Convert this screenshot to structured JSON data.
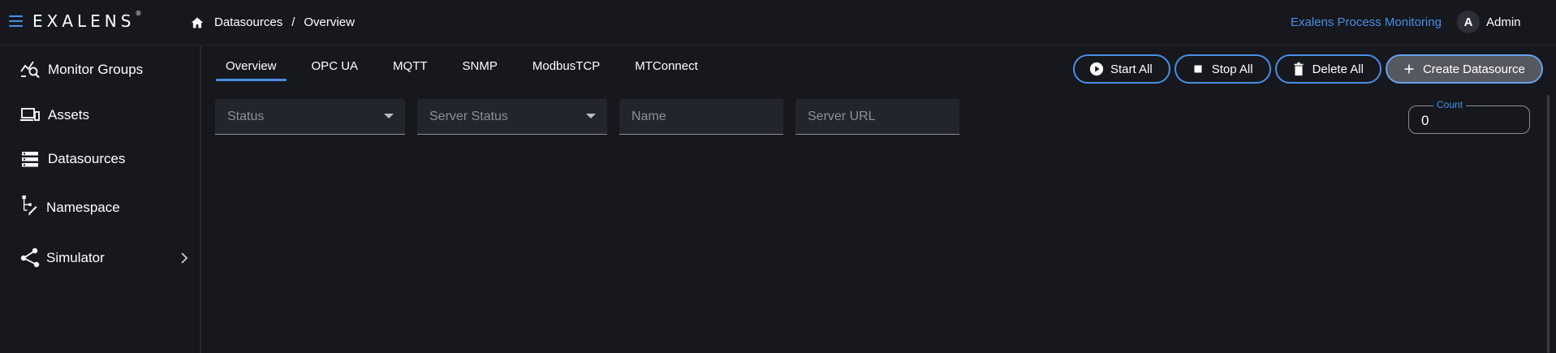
{
  "header": {
    "logo_text": "EXALENS",
    "logo_mark": "®",
    "breadcrumb": [
      "Datasources",
      "Overview"
    ],
    "breadcrumb_sep": "/",
    "app_link": "Exalens Process Monitoring",
    "user": {
      "initial": "A",
      "name": "Admin"
    }
  },
  "sidebar": {
    "items": [
      {
        "label": "Monitor Groups",
        "icon": "monitor-groups-icon"
      },
      {
        "label": "Assets",
        "icon": "assets-icon"
      },
      {
        "label": "Datasources",
        "icon": "datasources-icon"
      },
      {
        "label": "Namespace",
        "icon": "namespace-icon"
      },
      {
        "label": "Simulator",
        "icon": "simulator-icon"
      }
    ]
  },
  "tabs": [
    "Overview",
    "OPC UA",
    "MQTT",
    "SNMP",
    "ModbusTCP",
    "MTConnect"
  ],
  "actions": {
    "start_all": "Start All",
    "stop_all": "Stop All",
    "delete_all": "Delete All",
    "create_datasource": "Create Datasource"
  },
  "filters": {
    "status": "Status",
    "server_status": "Server Status",
    "name": "Name",
    "server_url": "Server URL"
  },
  "count": {
    "label": "Count",
    "value": "0"
  },
  "colors": {
    "accent": "#4a8ee6",
    "background": "#16181d",
    "field": "#22252b"
  }
}
